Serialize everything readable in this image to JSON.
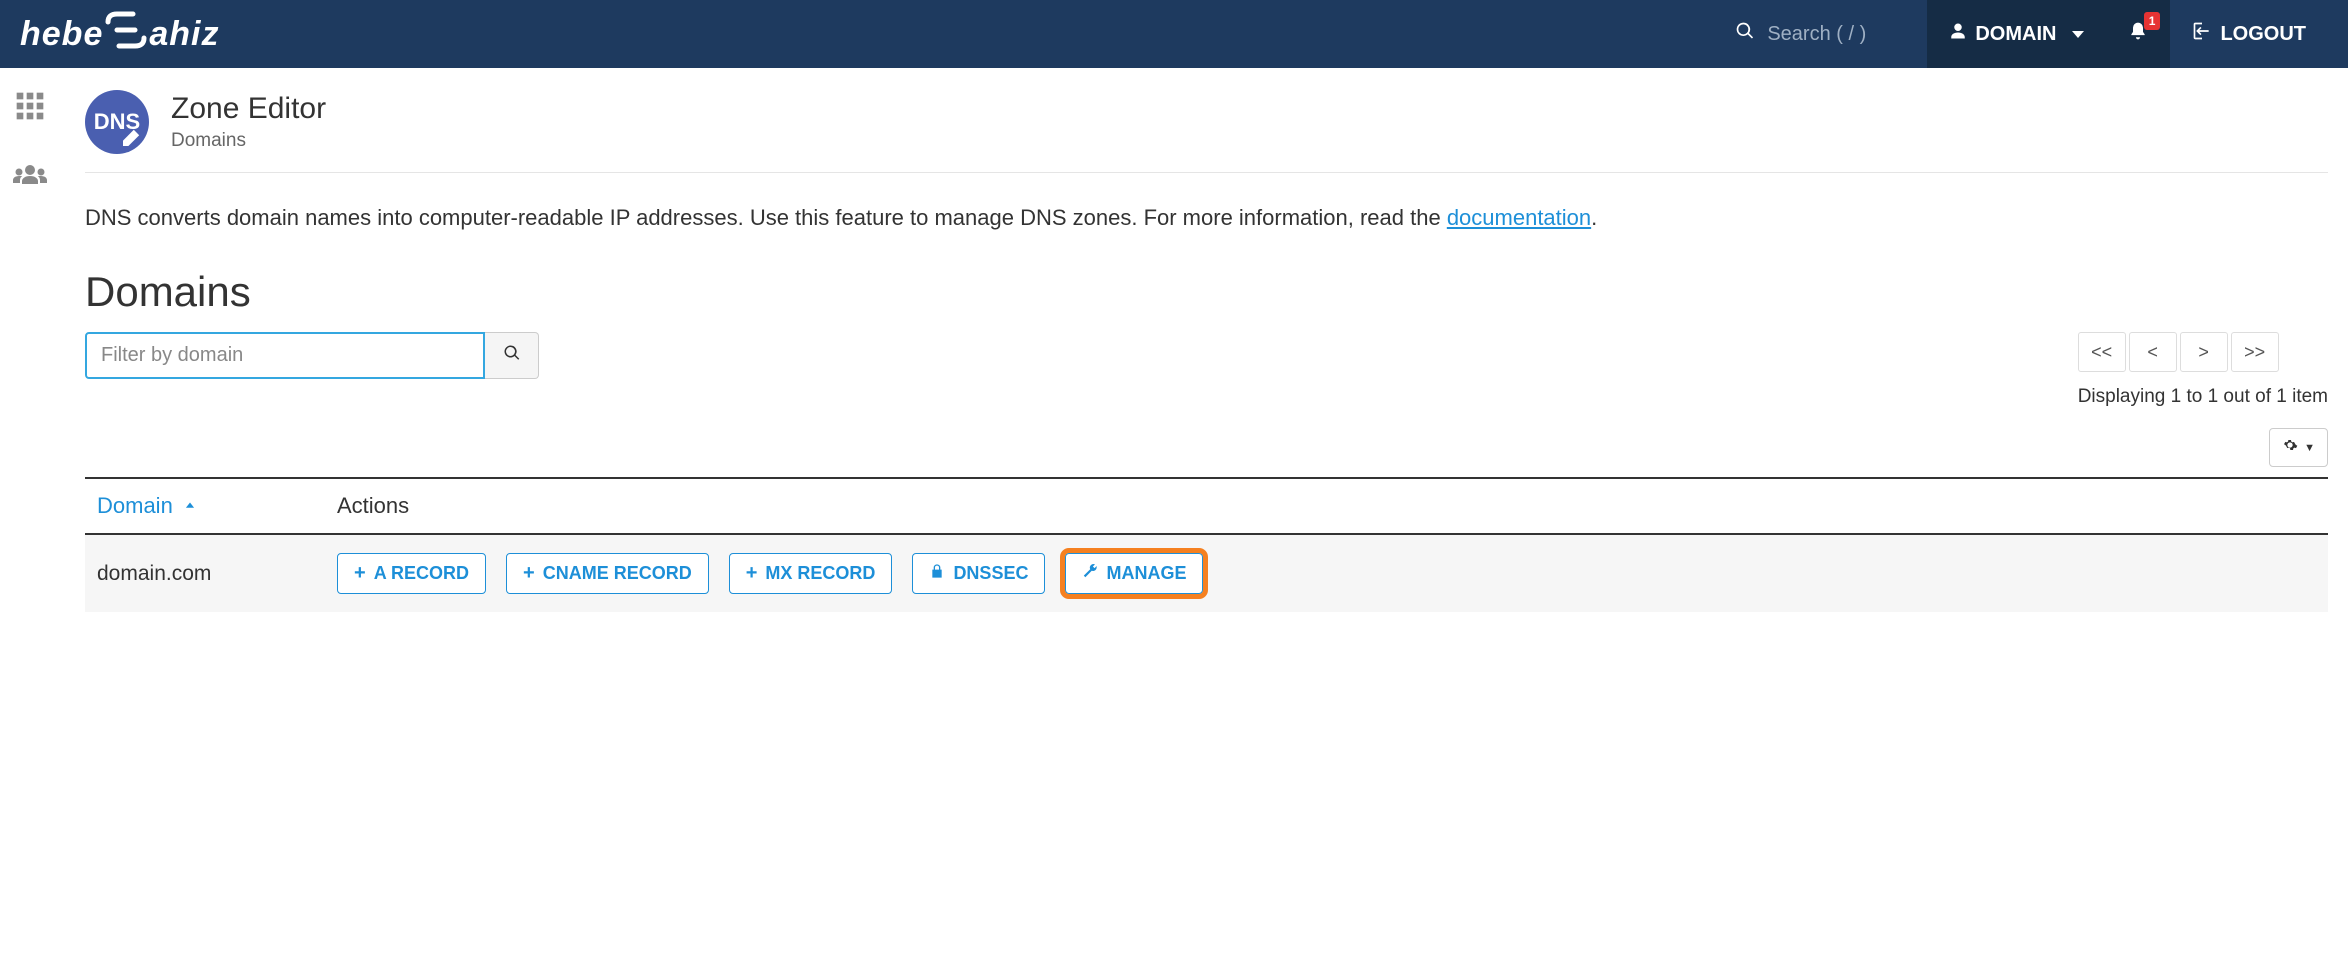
{
  "header": {
    "brand": "heberjahiz",
    "search_placeholder": "Search ( / )",
    "user_label": "DOMAIN",
    "notifications": "1",
    "logout_label": "LOGOUT"
  },
  "page": {
    "title": "Zone Editor",
    "subtitle": "Domains",
    "description_pre": "DNS converts domain names into computer-readable IP addresses. Use this feature to manage DNS zones. For more information, read the ",
    "description_link": "documentation",
    "description_post": "."
  },
  "domains": {
    "heading": "Domains",
    "filter_placeholder": "Filter by domain",
    "display_info": "Displaying 1 to 1 out of 1 item",
    "pager": {
      "first": "<<",
      "prev": "<",
      "next": ">",
      "last": ">>"
    },
    "columns": {
      "domain": "Domain",
      "actions": "Actions"
    },
    "rows": [
      {
        "domain": "domain.com",
        "actions": {
          "a_record": "A RECORD",
          "cname_record": "CNAME RECORD",
          "mx_record": "MX RECORD",
          "dnssec": "DNSSEC",
          "manage": "MANAGE"
        }
      }
    ]
  }
}
